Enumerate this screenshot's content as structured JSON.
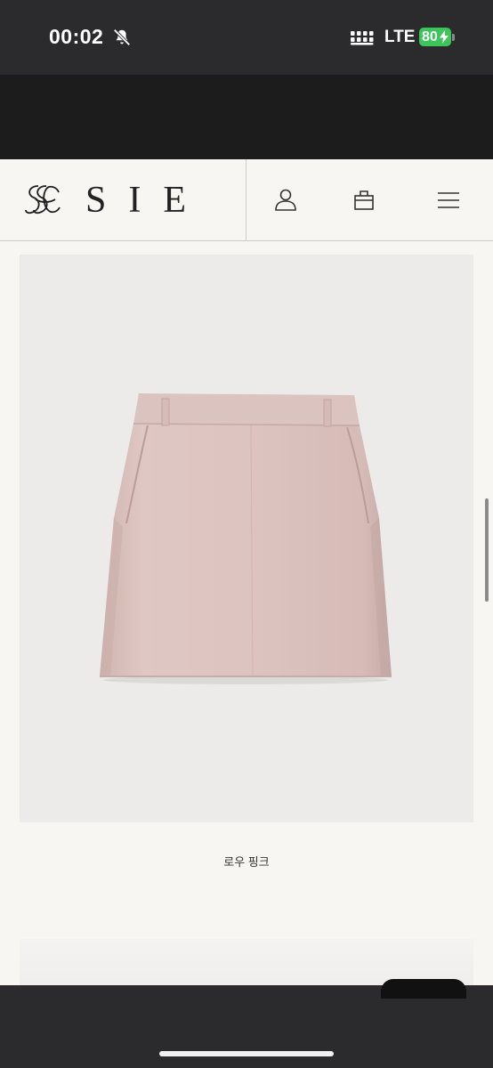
{
  "status_bar": {
    "time": "00:02",
    "network": "LTE",
    "battery": "80",
    "bell_icon": "bell-slash-icon",
    "signal_icon": "signal-bars-icon",
    "battery_color": "#3bc55a"
  },
  "header": {
    "brand": "SIE",
    "logo_icon": "sie-monogram-icon",
    "icons": [
      "user-icon",
      "shopping-bag-icon",
      "menu-icon"
    ]
  },
  "product": {
    "image": "pink-mini-skirt",
    "color_name": "로우 핑크"
  },
  "colors": {
    "skirt": "#dcc3bf",
    "card_bg": "#ecebe9",
    "page_bg": "#f7f6f3"
  }
}
